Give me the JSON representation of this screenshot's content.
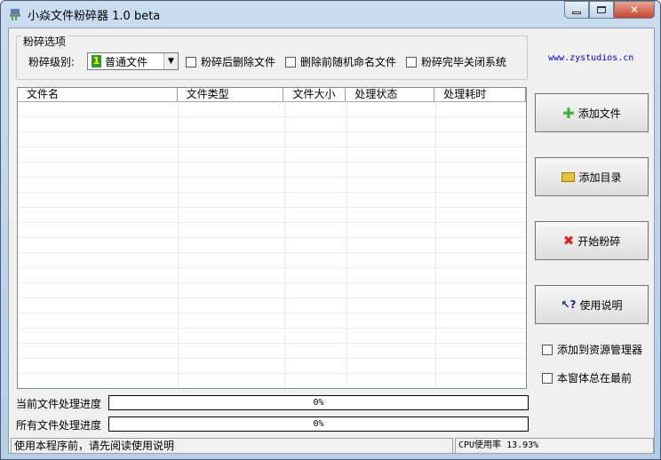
{
  "window": {
    "title": "小焱文件粉碎器 1.0 beta"
  },
  "options": {
    "group_label": "粉碎选项",
    "level_label": "粉碎级别:",
    "level_value": "普通文件",
    "level_number": "1",
    "checkboxes": [
      {
        "label": "粉碎后删除文件",
        "checked": false
      },
      {
        "label": "删除前随机命名文件",
        "checked": false
      },
      {
        "label": "粉碎完毕关闭系统",
        "checked": false
      }
    ]
  },
  "website": "www.zystudios.cn",
  "list": {
    "columns": [
      "文件名",
      "文件类型",
      "文件大小",
      "处理状态",
      "处理耗时"
    ],
    "rows": []
  },
  "buttons": {
    "add_file": "添加文件",
    "add_dir": "添加目录",
    "start": "开始粉碎",
    "help": "使用说明"
  },
  "side_checkboxes": [
    {
      "label": "添加到资源管理器",
      "checked": false
    },
    {
      "label": "本窗体总在最前",
      "checked": false
    }
  ],
  "progress": {
    "current_label": "当前文件处理进度",
    "current_value": "0%",
    "all_label": "所有文件处理进度",
    "all_value": "0%"
  },
  "status": {
    "message": "使用本程序前，请先阅读使用说明",
    "cpu": "CPU使用率 13.93%"
  }
}
